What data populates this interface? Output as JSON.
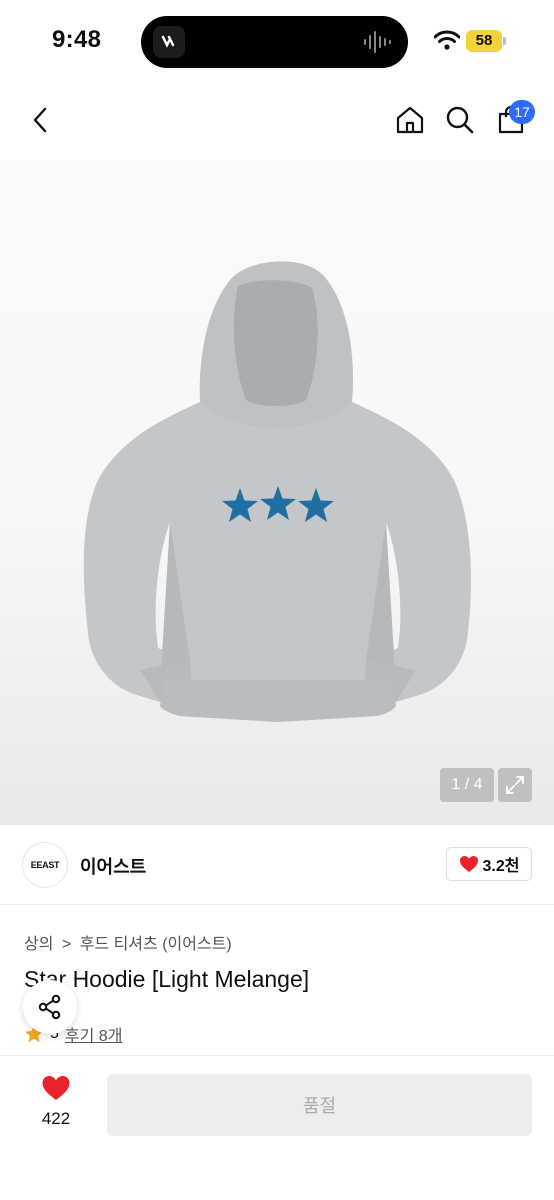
{
  "status_bar": {
    "time": "9:48",
    "battery": "58"
  },
  "nav": {
    "cart_count": "17"
  },
  "gallery": {
    "pager": "1 / 4"
  },
  "brand": {
    "logo_text": "EEAST",
    "name": "이어스트",
    "like_count": "3.2천"
  },
  "breadcrumb": {
    "category": "상의",
    "separator": ">",
    "subcategory": "후드 티셔츠 (이어스트)"
  },
  "product": {
    "title": "Star Hoodie [Light Melange]",
    "rating": "5",
    "review_label": "후기 8개"
  },
  "bottom_bar": {
    "like_count": "422",
    "buy_label": "품절"
  },
  "colors": {
    "accent_blue": "#2f6bff",
    "heart_red": "#e8232b",
    "star_blue": "#1f6fa3"
  }
}
